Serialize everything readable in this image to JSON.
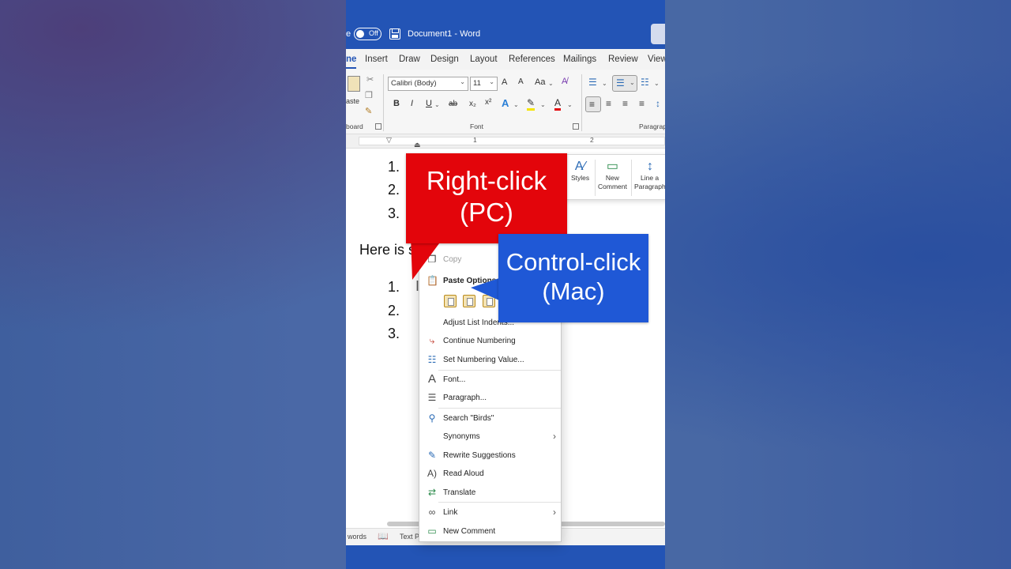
{
  "titlebar": {
    "autosave_fragment": "e",
    "autosave_state": "Off",
    "doc_name": "Document1",
    "separator": "-",
    "app_name": "Word"
  },
  "tabs": [
    "ne",
    "Insert",
    "Draw",
    "Design",
    "Layout",
    "References",
    "Mailings",
    "Review",
    "View"
  ],
  "ribbon": {
    "paste_label": "aste",
    "clipboard_label": "board",
    "font_name": "Calibri (Body)",
    "font_size": "11",
    "grow_font": "A",
    "shrink_font": "A",
    "change_case": "Aa",
    "bold": "B",
    "italic": "I",
    "underline": "U",
    "strike": "ab",
    "subscript": "x₂",
    "superscript": "x²",
    "text_effects": "A",
    "font_color": "A",
    "font_group_label": "Font",
    "paragraph_group_label": "Paragrap"
  },
  "ruler": {
    "marks": [
      "1",
      "2"
    ]
  },
  "document": {
    "list1": [
      "1.",
      "2.",
      "3."
    ],
    "body_text": "Here is s",
    "list2": [
      "1.",
      "2.",
      "3."
    ]
  },
  "mini_toolbar": {
    "styles": "Styles",
    "new_comment_line1": "New",
    "new_comment_line2": "Comment",
    "line_para_line1": "Line a",
    "line_para_line2": "Paragraph"
  },
  "context_menu": {
    "copy": "Copy",
    "paste_options": "Paste Options",
    "adjust_list_indents": "Adjust List Indents...",
    "continue_numbering": "Continue Numbering",
    "set_numbering_value": "Set Numbering Value...",
    "font": "Font...",
    "paragraph": "Paragraph...",
    "search": "Search \"Birds\"",
    "synonyms": "Synonyms",
    "rewrite_suggestions": "Rewrite Suggestions",
    "read_aloud": "Read Aloud",
    "translate": "Translate",
    "link": "Link",
    "new_comment": "New Comment"
  },
  "statusbar": {
    "words": "words",
    "text_predictions": "Text Pr"
  },
  "callouts": {
    "pc_line1": "Right-click",
    "pc_line2": "(PC)",
    "mac_line1": "Control-click",
    "mac_line2": "(Mac)"
  },
  "colors": {
    "word_blue": "#2354b5",
    "callout_red": "#e3050b",
    "callout_blue": "#1f58d6"
  }
}
